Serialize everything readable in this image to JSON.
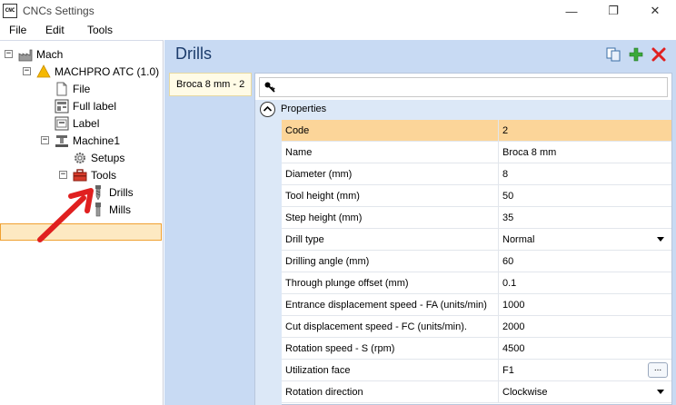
{
  "window": {
    "title": "CNCs Settings",
    "app_icon_text": "CNC",
    "minimize": "—",
    "maximize": "❐",
    "close": "✕"
  },
  "menu": [
    "File",
    "Edit",
    "Tools"
  ],
  "tree": {
    "root": "Mach",
    "machine": "MACHPRO ATC (1.0)",
    "file": "File",
    "full_label": "Full label",
    "label": "Label",
    "machine1": "Machine1",
    "setups": "Setups",
    "tools": "Tools",
    "drills": "Drills",
    "mills": "Mills",
    "selected": "Drills"
  },
  "panel": {
    "title": "Drills",
    "selected_item": "Broca 8 mm - 2",
    "category": "Properties"
  },
  "properties": [
    {
      "name": "Code",
      "value": "2"
    },
    {
      "name": "Name",
      "value": "Broca 8 mm"
    },
    {
      "name": "Diameter (mm)",
      "value": "8"
    },
    {
      "name": "Tool height (mm)",
      "value": "50"
    },
    {
      "name": "Step height (mm)",
      "value": "35"
    },
    {
      "name": "Drill type",
      "value": "Normal"
    },
    {
      "name": "Drilling angle (mm)",
      "value": "60"
    },
    {
      "name": "Through plunge offset (mm)",
      "value": "0.1"
    },
    {
      "name": "Entrance displacement speed - FA (units/min)",
      "value": "1000"
    },
    {
      "name": "Cut displacement speed - FC (units/min).",
      "value": "2000"
    },
    {
      "name": "Rotation speed - S (rpm)",
      "value": "4500"
    },
    {
      "name": "Utilization face",
      "value": "F1"
    },
    {
      "name": "Rotation direction",
      "value": "Clockwise"
    }
  ],
  "ellipsis_label": "...",
  "colors": {
    "panel_bg": "#c8daf3",
    "selection": "#fcd599",
    "accent_red": "#e02020",
    "accent_green": "#3aa93a"
  }
}
